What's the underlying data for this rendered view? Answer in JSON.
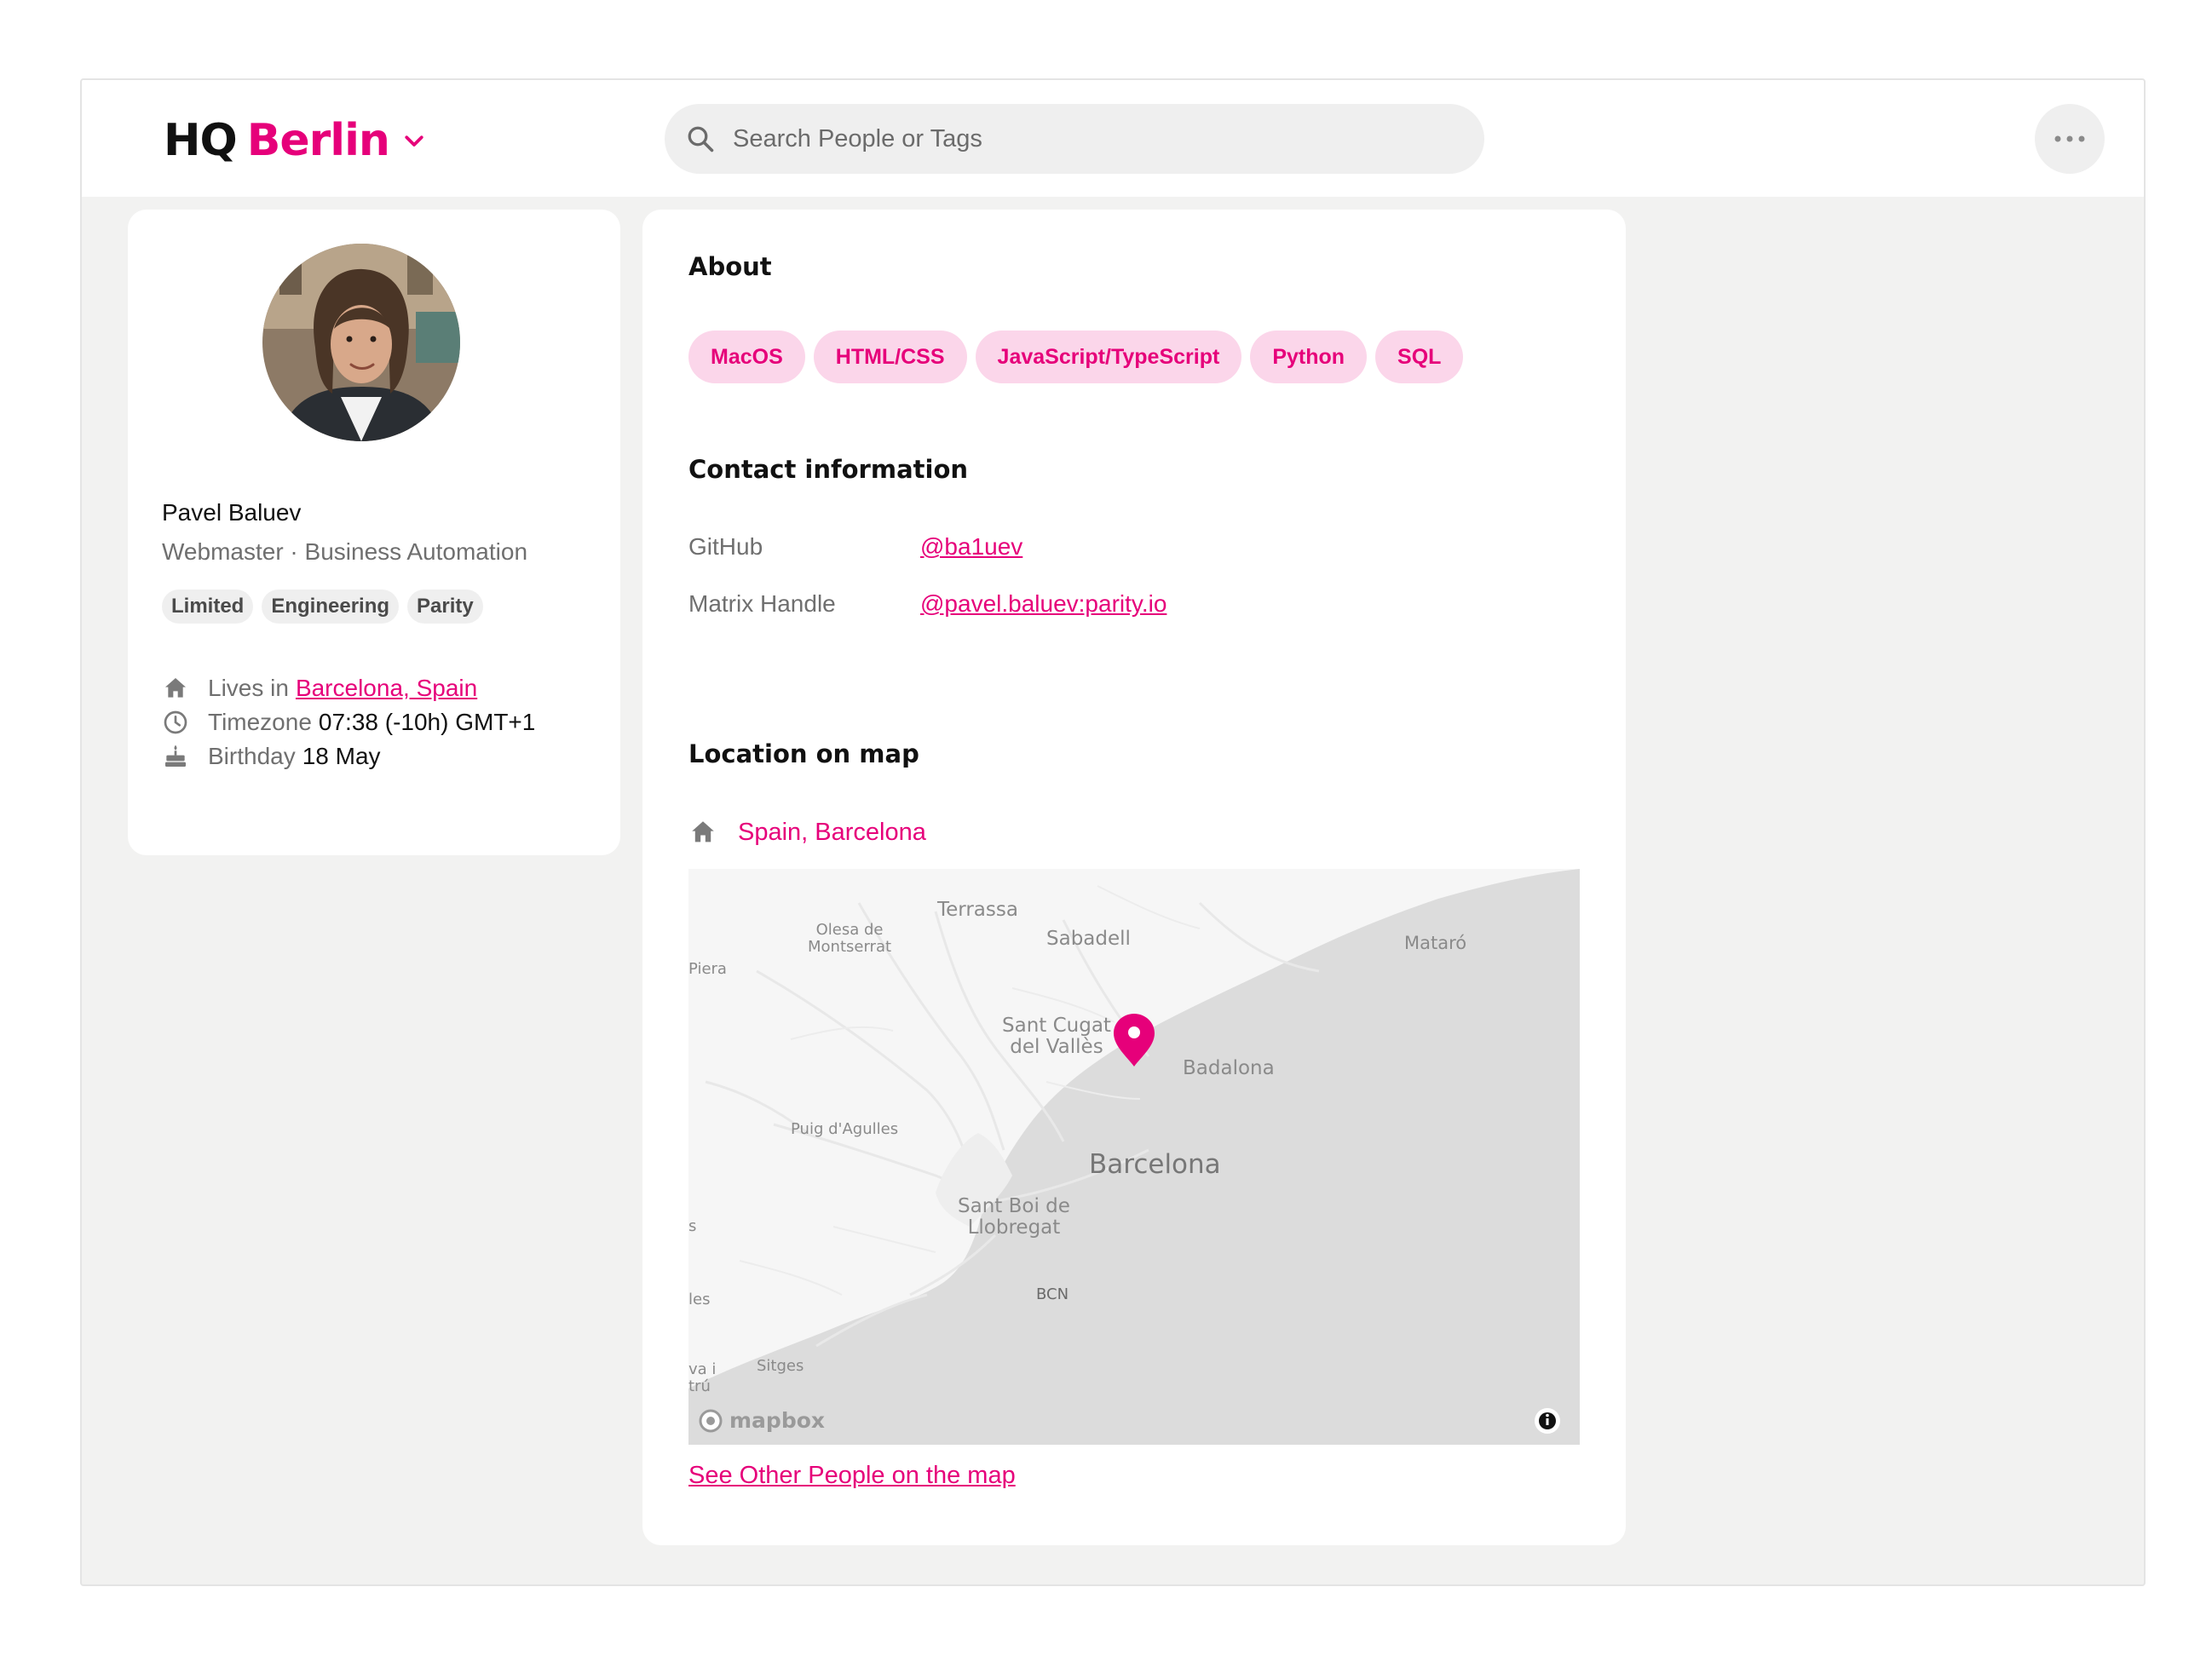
{
  "brand": {
    "prefix": "HQ",
    "city": "Berlin"
  },
  "search": {
    "placeholder": "Search People or Tags"
  },
  "profile": {
    "name": "Pavel Baluev",
    "role": "Webmaster · Business Automation",
    "tags": [
      "Limited",
      "Engineering",
      "Parity"
    ],
    "lives_label": "Lives in",
    "lives_value": "Barcelona, Spain",
    "timezone_label": "Timezone",
    "timezone_value": "07:38 (-10h) GMT+1",
    "birthday_label": "Birthday",
    "birthday_value": "18 May"
  },
  "about": {
    "title": "About",
    "skills": [
      "MacOS",
      "HTML/CSS",
      "JavaScript/TypeScript",
      "Python",
      "SQL"
    ]
  },
  "contact": {
    "title": "Contact information",
    "rows": [
      {
        "label": "GitHub",
        "value": "@ba1uev"
      },
      {
        "label": "Matrix Handle",
        "value": "@pavel.baluev:parity.io"
      }
    ]
  },
  "location": {
    "title": "Location on map",
    "place": "Spain, Barcelona",
    "map_labels": {
      "terrassa": "Terrassa",
      "sabadell": "Sabadell",
      "olesa": "Olesa de\nMontserrat",
      "piera": "Piera",
      "mataro": "Mataró",
      "sant_cugat": "Sant Cugat\ndel Vallès",
      "badalona": "Badalona",
      "puig": "Puig d'Agulles",
      "barcelona": "Barcelona",
      "sant_boi": "Sant Boi de\nLlobregat",
      "bcn": "BCN",
      "sitges": "Sitges",
      "les": "les",
      "vai": "va i\ntrú",
      "s": "s"
    },
    "map_brand": "mapbox",
    "see_other": "See Other People on the map"
  },
  "colors": {
    "accent": "#e6007a",
    "tag_bg": "#fbd6ea",
    "page_bg": "#f2f2f1"
  },
  "icons": [
    "chevron-down-icon",
    "search-icon",
    "more-icon",
    "home-icon",
    "clock-icon",
    "cake-icon",
    "map-pin-icon",
    "info-icon"
  ]
}
